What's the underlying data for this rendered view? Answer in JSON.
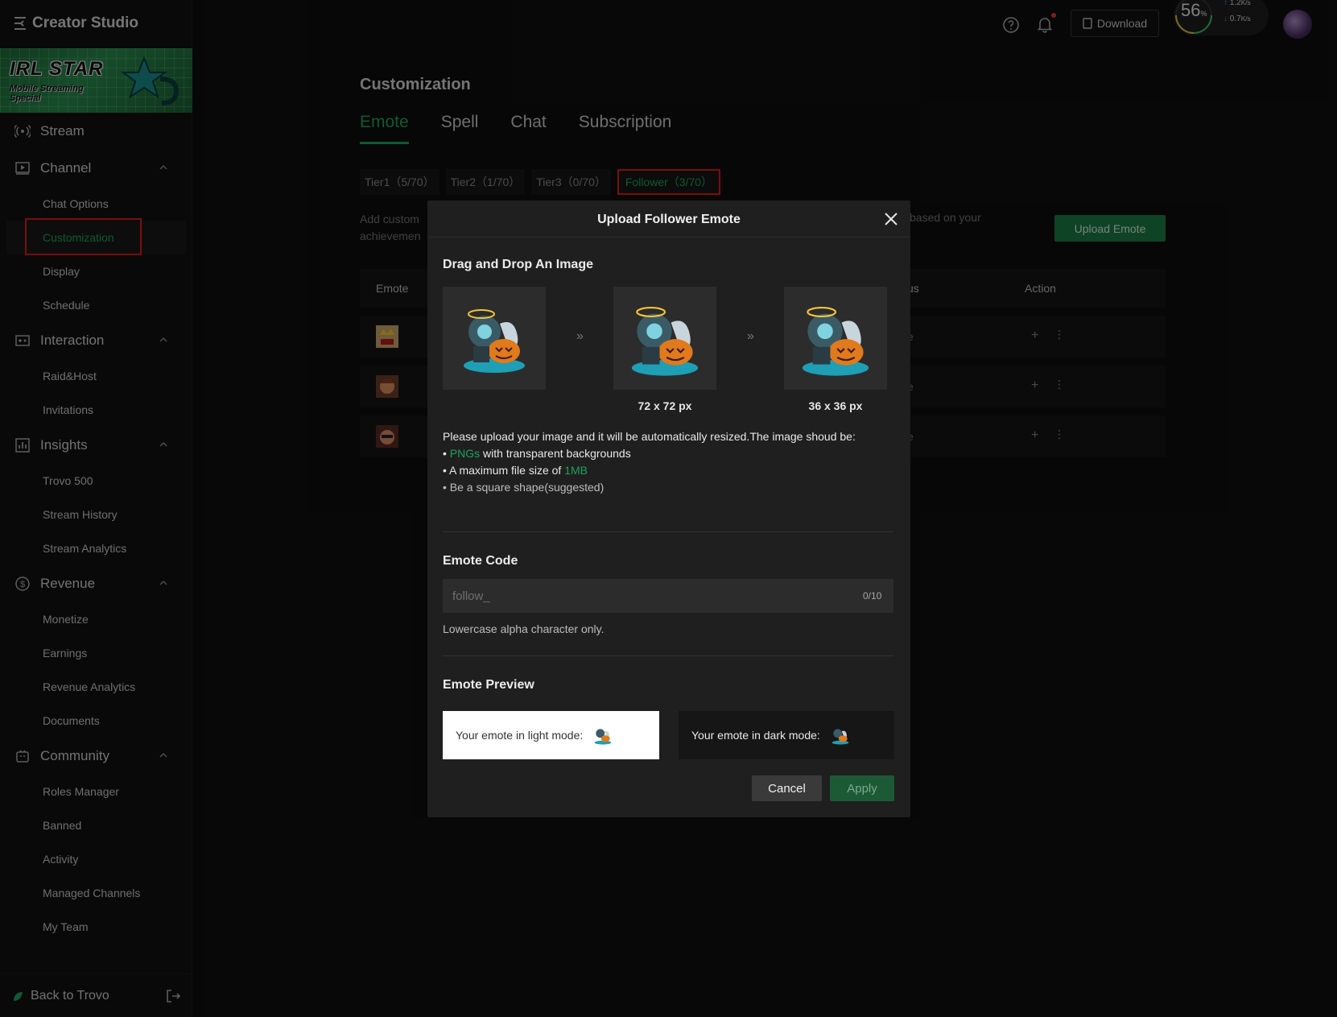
{
  "app": {
    "title": "Creator Studio"
  },
  "banner": {
    "line1": "IRL STAR",
    "line2": "Mobile Streaming",
    "line3": "Special"
  },
  "sidebar": {
    "stream": "Stream",
    "channel": {
      "label": "Channel",
      "items": [
        "Chat Options",
        "Customization",
        "Display",
        "Schedule"
      ]
    },
    "interaction": {
      "label": "Interaction",
      "items": [
        "Raid&Host",
        "Invitations"
      ]
    },
    "insights": {
      "label": "Insights",
      "items": [
        "Trovo 500",
        "Stream History",
        "Stream Analytics"
      ]
    },
    "revenue": {
      "label": "Revenue",
      "items": [
        "Monetize",
        "Earnings",
        "Revenue Analytics",
        "Documents"
      ]
    },
    "community": {
      "label": "Community",
      "items": [
        "Roles Manager",
        "Banned",
        "Activity",
        "Managed Channels",
        "My Team"
      ]
    },
    "back": "Back to Trovo"
  },
  "topbar": {
    "download": "Download",
    "speed": {
      "percent": "56",
      "percent_unit": "%",
      "up": "1.2",
      "down": "0.7",
      "unit": "K/s"
    }
  },
  "main": {
    "title": "Customization",
    "tabs": [
      "Emote",
      "Spell",
      "Chat",
      "Subscription"
    ],
    "active_tab": "Emote",
    "tiers": [
      "Tier1（5/70）",
      "Tier2（1/70）",
      "Tier3（0/70）",
      "Follower（3/70）"
    ],
    "desc_line1": "Add custom",
    "desc_line2": "achievemen",
    "desc_right": "based on your",
    "upload_button": "Upload Emote",
    "table": {
      "col_emote": "Emote",
      "col_status": "us",
      "col_action": "Action",
      "rows": [
        {
          "status": "e",
          "plus": "+",
          "more": "⋮"
        },
        {
          "status": "e",
          "plus": "+",
          "more": "⋮"
        },
        {
          "status": "e",
          "plus": "+",
          "more": "⋮"
        }
      ]
    }
  },
  "modal": {
    "title": "Upload Follower Emote",
    "drag_heading": "Drag and Drop An Image",
    "arrow": "»",
    "size_72": "72 x 72 px",
    "size_36": "36 x 36 px",
    "rules_intro": "Please upload your image and it will be automatically resized.The image shoud be:",
    "rule1_highlight": "PNGs",
    "rule1_rest": " with transparent backgrounds",
    "rule2_text": "A maximum file size of ",
    "rule2_highlight": "1MB",
    "rule3": "Be a square shape(suggested)",
    "code_heading": "Emote Code",
    "code_placeholder": "follow_",
    "code_counter": "0/10",
    "code_hint": "Lowercase alpha character only.",
    "preview_heading": "Emote Preview",
    "preview_light": "Your emote in light mode:",
    "preview_dark": "Your emote in dark mode:",
    "cancel": "Cancel",
    "apply": "Apply"
  },
  "colors": {
    "accent": "#1ea35a",
    "highlight_box": "#e01b1b",
    "modal_bg": "#1f1f1f"
  }
}
